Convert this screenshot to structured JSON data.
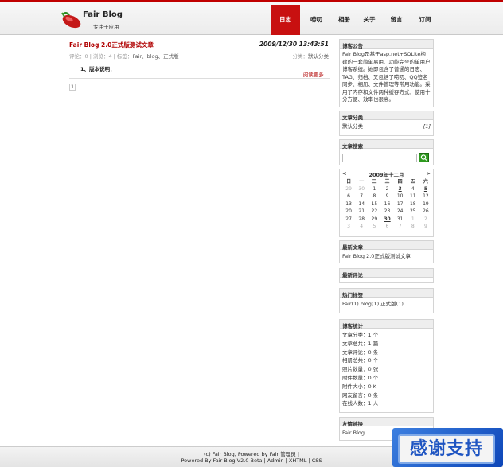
{
  "header": {
    "title": "Fair Blog",
    "subtitle": "专注于应用",
    "nav": [
      "日志",
      "唠叨",
      "相册",
      "关于",
      "留言",
      "订阅"
    ]
  },
  "post": {
    "title": "Fair Blog 2.0正式版测试文章",
    "date": "2009/12/30 13:43:51",
    "meta_prefix": "评论：",
    "meta_comments": "0",
    "meta_views_label": " | 浏览：",
    "meta_views": "4",
    "meta_tags_label": " | 标签：",
    "meta_tags": "Fair、blog、正式版",
    "category_label": "分类：",
    "category": "默认分类",
    "body": "1、版本说明：",
    "read_more": "阅读更多...",
    "page": "1"
  },
  "sidebar": {
    "notice": {
      "title": "博客公告",
      "text": "Fair Blog是基于asp.net+SQLite构建的一套简单易用、功能完全的单用户博客系统。她即包含了普通的日志、TAG、归档、又包括了唠叨、QQ签名同步、相册、文件管理等常用功能。采用了内存和文件两种缓存方式，使用十分方便、效率也很高。"
    },
    "categories": {
      "title": "文章分类",
      "items": [
        {
          "name": "默认分类",
          "count": "[1]"
        }
      ]
    },
    "search": {
      "title": "文章搜索"
    },
    "calendar": {
      "prev": "<",
      "month": "2009年十二月",
      "next": ">",
      "weekdays": [
        "日",
        "一",
        "二",
        "三",
        "四",
        "五",
        "六"
      ],
      "weeks": [
        [
          "29",
          "30",
          "1",
          "2",
          "3",
          "4",
          "5"
        ],
        [
          "6",
          "7",
          "8",
          "9",
          "10",
          "11",
          "12"
        ],
        [
          "13",
          "14",
          "15",
          "16",
          "17",
          "18",
          "19"
        ],
        [
          "20",
          "21",
          "22",
          "23",
          "24",
          "25",
          "26"
        ],
        [
          "27",
          "28",
          "29",
          "30",
          "31",
          "1",
          "2"
        ],
        [
          "3",
          "4",
          "5",
          "6",
          "7",
          "8",
          "9"
        ]
      ]
    },
    "latest": {
      "title": "最新文章",
      "items": [
        "Fair Blog 2.0正式版测试文章"
      ]
    },
    "comments": {
      "title": "最新评论"
    },
    "tags": {
      "title": "热门标签",
      "text": "Fair(1) blog(1) 正式版(1)"
    },
    "stats": {
      "title": "博客统计",
      "items": [
        "文章分类：1 个",
        "文章总共：1 篇",
        "文章评论：0 条",
        "相册总共：0 个",
        "照片数量：0 张",
        "附件数量：0 个",
        "附件大小：0 K",
        "网友留言：0 条",
        "在线人数：1 人"
      ]
    },
    "links": {
      "title": "友情链接",
      "items": [
        "Fair Blog"
      ]
    }
  },
  "footer": {
    "line1": "(c) Fair Blog, Powered by Fair 管理员 |",
    "line2": "Powered By Fair Blog V2.0 Beta | Admin | XHTML | CSS"
  },
  "badge": {
    "text": "感谢支持"
  }
}
